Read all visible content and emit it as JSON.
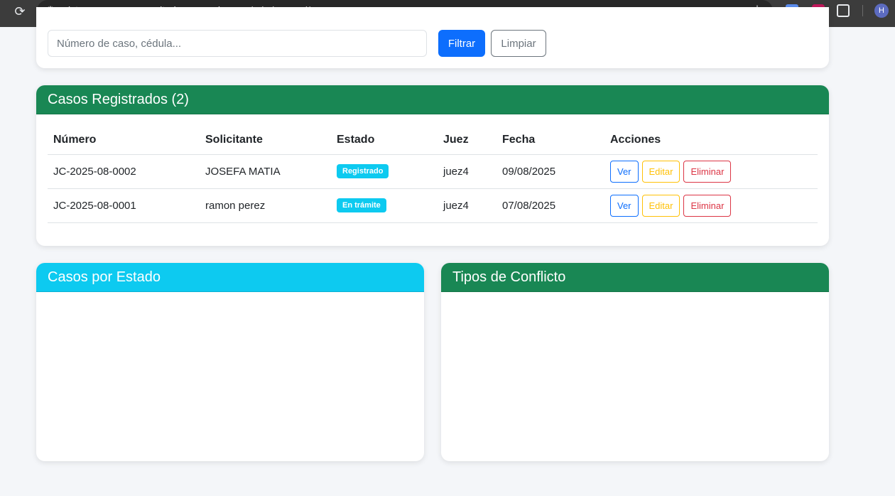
{
  "browser": {
    "url_host": "sistema-casos-comunitarios.onrender.com",
    "url_path": "/admin-panel/",
    "avatar_letter": "H"
  },
  "filter": {
    "search_placeholder": "Número de caso, cédula...",
    "filter_label": "Filtrar",
    "clear_label": "Limpiar"
  },
  "cases": {
    "title": "Casos Registrados (2)",
    "columns": [
      "Número",
      "Solicitante",
      "Estado",
      "Juez",
      "Fecha",
      "Acciones"
    ],
    "rows": [
      {
        "numero": "JC-2025-08-0002",
        "solicitante": "JOSEFA MATIA",
        "estado": "Registrado",
        "juez": "juez4",
        "fecha": "09/08/2025"
      },
      {
        "numero": "JC-2025-08-0001",
        "solicitante": "ramon perez",
        "estado": "En trámite",
        "juez": "juez4",
        "fecha": "07/08/2025"
      }
    ],
    "actions": {
      "view": "Ver",
      "edit": "Editar",
      "delete": "Eliminar"
    }
  },
  "state_chart": {
    "title": "Casos por Estado"
  },
  "conflict_chart": {
    "title": "Tipos de Conflicto"
  },
  "colors": {
    "primary": "#0d6efd",
    "success": "#198754",
    "info": "#0dcaf0",
    "warning": "#ffc107",
    "danger": "#dc3545"
  }
}
